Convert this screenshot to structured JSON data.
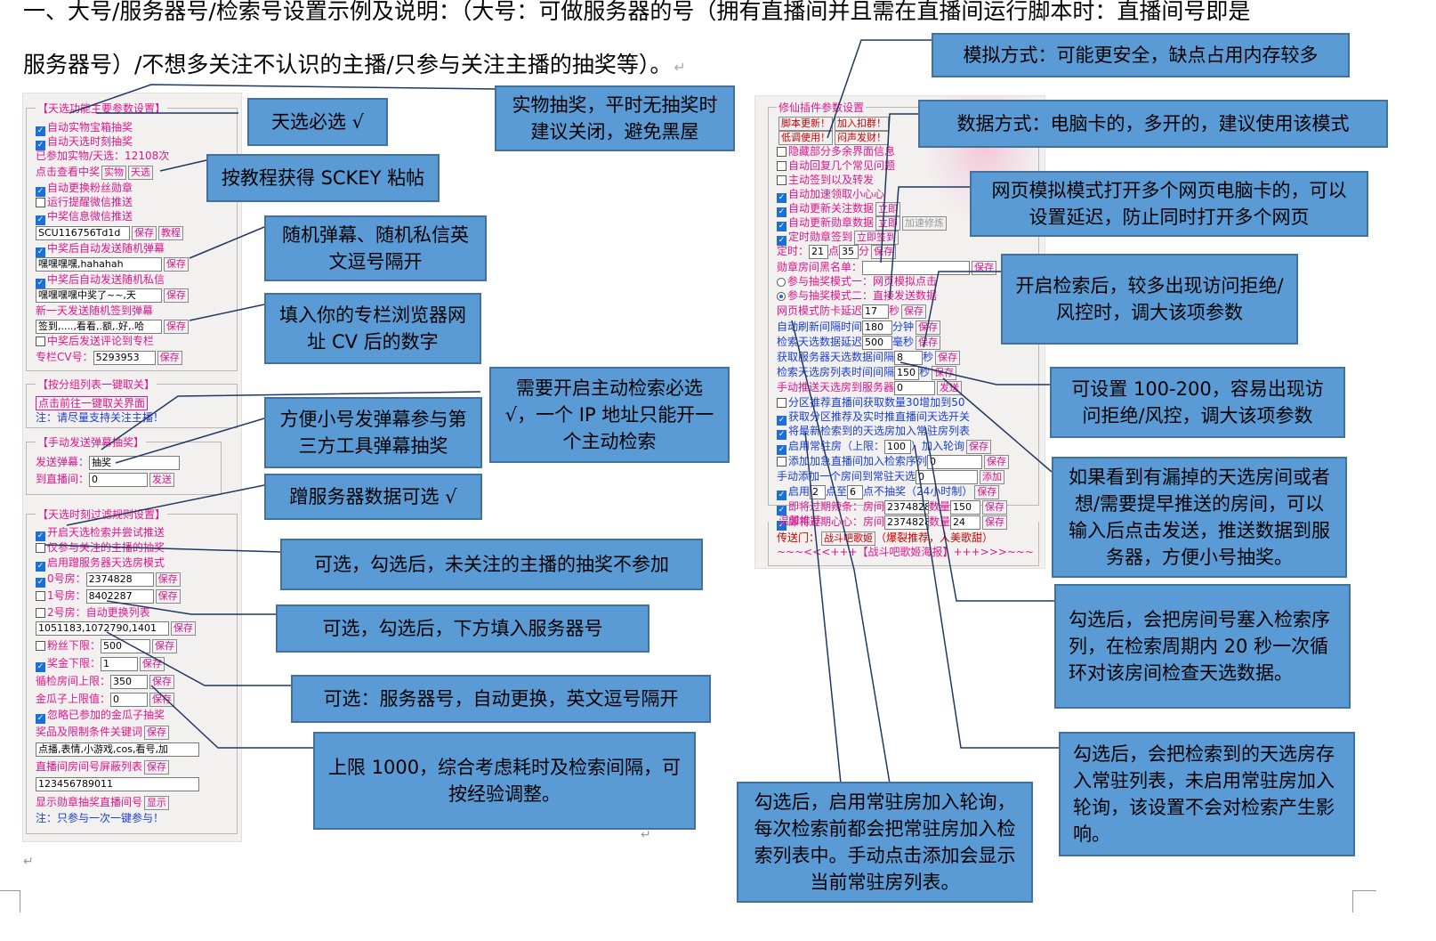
{
  "heading": {
    "line1": "一、大号/服务器号/检索号设置示例及说明：（大号：可做服务器的号（拥有直播间并且需在直播间运行脚本时：直播间号即是",
    "line2": "服务器号）/不想多关注不认识的主播/只参与关注主播的抽奖等）。"
  },
  "callouts": {
    "c1": "天选必选 √",
    "c2": "实物抽奖，平时无抽奖时建议关闭，避免黑屋",
    "c3": "按教程获得 SCKEY 粘帖",
    "c4": "随机弹幕、随机私信英文逗号隔开",
    "c5": "填入你的专栏浏览器网址 CV 后的数字",
    "c6": "需要开启主动检索必选√，一个 IP 地址只能开一个主动检索",
    "c7": "方便小号发弹幕参与第三方工具弹幕抽奖",
    "c8": "蹭服务器数据可选 √",
    "c9": "可选，勾选后，未关注的主播的抽奖不参加",
    "c10": "可选，勾选后，下方填入服务器号",
    "c11": "可选：服务器号，自动更换，英文逗号隔开",
    "c12": "上限 1000，综合考虑耗时及检索间隔，可按经验调整。",
    "r1": "模拟方式：可能更安全，缺点占用内存较多",
    "r2": "数据方式：电脑卡的，多开的，建议使用该模式",
    "r3": "网页模拟模式打开多个网页电脑卡的，可以设置延迟，防止同时打开多个网页",
    "r4": "开启检索后，较多出现访问拒绝/风控时，调大该项参数",
    "r5": "可设置 100-200，容易出现访问拒绝/风控，调大该项参数",
    "r6": "如果看到有漏掉的天选房间或者想/需要提早推送的房间，可以输入后点击发送，推送数据到服务器，方便小号抽奖。",
    "r7": "勾选后，会把房间号塞入检索序列，在检索周期内 20 秒一次循环对该房间检查天选数据。",
    "r8": "勾选后，会把检索到的天选房存入常驻列表，未启用常驻房加入轮询，该设置不会对检索产生影响。",
    "r9": "勾选后，启用常驻房加入轮询，每次检索前都会把常驻房加入检索列表中。手动点击添加会显示当前常驻房列表。"
  },
  "left_panel": {
    "g1_title": "【天选功能主要参数设置】",
    "auto_gold": "自动实物宝箱抽奖",
    "auto_anchor": "自动天选时刻抽奖",
    "joined_count": "已参加实物/天选：12108次",
    "check_win": "点击查看中奖",
    "btn_real": "实物",
    "btn_anchor": "天选",
    "auto_medal": "自动更换粉丝勋章",
    "run_wechat": "运行提醒微信推送",
    "win_wechat": "中奖信息微信推送",
    "sckey_val": "SCU116756Td1d",
    "btn_save": "保存",
    "btn_tutorial": "教程",
    "win_danmu": "中奖后自动发送随机弹幕",
    "danmu_val": "嘿嘿嘿嘿,hahahah",
    "win_pm": "中奖后自动发送随机私信",
    "pm_val": "嘿嘿嘿嘿中奖了~~,天",
    "new_day": "新一天发送随机签到弹幕",
    "sign_val": "签到,....,看看,.额,.好,.哈",
    "win_comment": "中奖后发送评论到专栏",
    "cv_label": "专栏CV号：",
    "cv_val": "5293953",
    "g2_title": "【按分组列表一键取关】",
    "go_unfollow": "点击前往一键取关界面",
    "note_support": "注：请尽量支持关注主播！",
    "g3_title": "【手动发送弹幕抽奖】",
    "send_danmu_label": "发送弹幕：",
    "send_danmu_val": "抽奖",
    "to_room_label": "到直播间：",
    "to_room_val": "0",
    "btn_send": "发送",
    "g4_title": "【天选时刻过滤规则设置】",
    "enable_search": "开启天选检索并尝试推送",
    "only_followed": "仅参与关注的主播的抽奖",
    "use_server": "启用蹭服务器天选房模式",
    "room0_label": "0号房：",
    "room0_val": "2374828",
    "room1_label": "1号房：",
    "room1_val": "8402287",
    "room2_label": "2号房：自动更换列表",
    "rooms_val": "1051183,1072790,1401",
    "fans_label": "粉丝下限：",
    "fans_val": "500",
    "prize_label": "奖金下限：",
    "prize_val": "1",
    "loop_label": "循检房间上限：",
    "loop_val": "350",
    "melon_label": "金瓜子上限值：",
    "melon_val": "0",
    "ignore_melon": "忽略已参加的金瓜子抽奖",
    "prize_keyword": "奖品及限制条件关键词",
    "keyword_val": "点播,表情,小游戏,cos,看号,加",
    "room_block": "直播间房间号屏蔽列表",
    "block_val": "123456789011",
    "show_medal_room": "显示勋章抽奖直播间号",
    "btn_show": "显示",
    "note_once": "注：只参与一次一键参与！"
  },
  "right_panel": {
    "g1_title": "修仙插件参数设置",
    "btn_update": "脚本更新！",
    "btn_join": "加入扣群！",
    "btn_low": "低调使用！",
    "btn_quiet": "闷声发财！",
    "hide_ui": "隐藏部分多余界面信息",
    "auto_reply": "自动回复几个常见问题",
    "auto_share": "主动签到以及转发",
    "auto_reward": "自动加速领取小心心",
    "auto_update_data": "自动更新关注数据",
    "btn_now_update": "立即",
    "auto_update_medal": "自动更新勋章数据",
    "btn_now_medal": "立即",
    "btn_speed": "加速修炼",
    "timer_sign": "定时勋章签到",
    "btn_now_sign": "立即签到",
    "time_label": "定时：",
    "time_h": "21",
    "time_dian": "点",
    "time_m": "35",
    "time_fen": "分",
    "blacklist_label": "勋章房间黑名单：",
    "mode1": "参与抽奖模式一：网页模拟点击",
    "mode2": "参与抽奖模式二：直接发送数据",
    "web_delay_label": "网页模式防卡延迟",
    "web_delay_val": "17",
    "web_delay_unit": "秒",
    "auto_refresh_label": "自动刷新间隔时间",
    "auto_refresh_val": "180",
    "auto_refresh_unit": "分钟",
    "search_delay_label": "检索天选数据延迟",
    "search_delay_val": "500",
    "search_delay_unit": "毫秒",
    "fetch_interval_label": "获取服务器天选数据间隔",
    "fetch_interval_val": "8",
    "fetch_interval_unit": "秒",
    "list_interval_label": "检索天选房列表时间间隔",
    "list_interval_val": "150",
    "list_interval_unit": "秒",
    "manual_push_label": "手动推送天选房到服务器",
    "manual_push_val": "0",
    "btn_push": "发送",
    "partition_label": "分区推荐直播间获取数量30增加到50",
    "get_partition": "获取分区推荐及实时推直播间天选开关",
    "add_new": "将最新检索到的天选房加入常驻房列表",
    "use_resident_label": "启用常驻房（上限：",
    "use_resident_val": "100",
    "use_resident_tail": "）加入轮询",
    "add_resident_label": "添加加急直播间加入检索序列",
    "add_resident_val": "0",
    "manual_add_label": "手动添加一个房间到常驻天选",
    "manual_add_val": "0",
    "btn_add": "添加",
    "enable_label": "启用",
    "enable_from": "2",
    "enable_to_label": "点至",
    "enable_to": "6",
    "enable_tail": "点不抽奖（24小时制）",
    "expire1_label": "即将过期辣条：房间",
    "expire1_room": "2374828",
    "expire1_count_label": "数量",
    "expire1_count": "150",
    "expire2_label": "即将过期心心：房间",
    "expire2_room": "2374828",
    "expire2_count_label": "数量",
    "expire2_count": "24",
    "g2_title": "温馨推荐",
    "portal_label": "传送门：",
    "portal_link": "战斗吧歌姬",
    "portal_tail": "（爆裂推荐，人美歌甜）",
    "wave": "~~~<<<+++【战斗吧歌姬海报】+++>>>~~~"
  },
  "colors": {
    "callout_fill": "#5b9bd5",
    "callout_border": "#41719c",
    "panel_pink": "#e0168c",
    "panel_blue": "#1a3fd8",
    "line": "#1f3864"
  }
}
